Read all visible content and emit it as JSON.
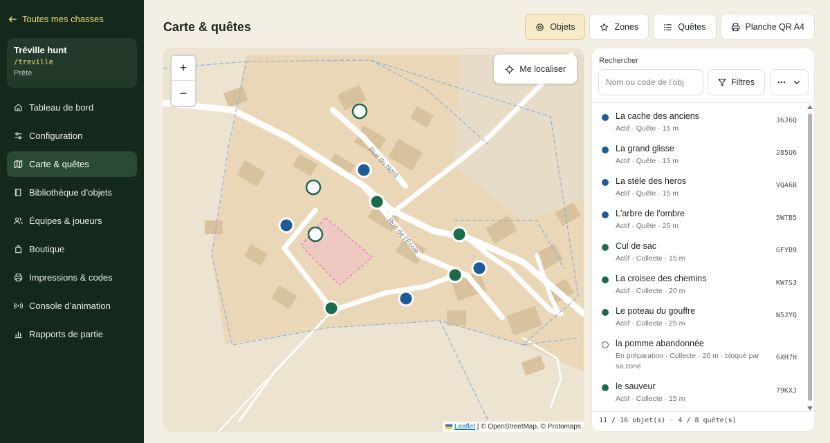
{
  "sidebar": {
    "back_label": "Toutes mes chasses",
    "hunt": {
      "name": "Tréville hunt",
      "slug": "/treville",
      "status": "Prête"
    },
    "items": [
      {
        "label": "Tableau de bord",
        "icon": "home-icon"
      },
      {
        "label": "Configuration",
        "icon": "sliders-icon"
      },
      {
        "label": "Carte & quêtes",
        "icon": "map-icon",
        "active": true
      },
      {
        "label": "Bibliothèque d’objets",
        "icon": "book-icon"
      },
      {
        "label": "Équipes & joueurs",
        "icon": "users-icon"
      },
      {
        "label": "Boutique",
        "icon": "bag-icon"
      },
      {
        "label": "Impressions & codes",
        "icon": "printer-icon"
      },
      {
        "label": "Console d’animation",
        "icon": "radio-icon"
      },
      {
        "label": "Rapports de partie",
        "icon": "chart-icon"
      }
    ]
  },
  "header": {
    "title": "Carte & quêtes",
    "buttons": {
      "objets": "Objets",
      "zones": "Zones",
      "quetes": "Quêtes",
      "qr": "Planche QR A4"
    }
  },
  "map": {
    "zoom_in": "+",
    "zoom_out": "−",
    "locate_label": "Me localiser",
    "streets": {
      "nord": "Rue du Nord",
      "ecole": "Rue de l'École"
    },
    "attribution": {
      "leaflet": "Leaflet",
      "rest": " | © OpenStreetMap, © Protomaps"
    },
    "colors": {
      "quest": "#1f5a99",
      "collect": "#1b6b4a",
      "draft": "#ffffff"
    }
  },
  "panel": {
    "search_label": "Rechercher",
    "search_placeholder": "Nom ou code de l’obj",
    "filters_label": "Filtres",
    "items": [
      {
        "title": "La cache des anciens",
        "meta": "Actif · Quête · 15 m",
        "code": "J6J6Q",
        "kind": "quest"
      },
      {
        "title": "La grand glisse",
        "meta": "Actif · Quête · 15 m",
        "code": "285U6",
        "kind": "quest"
      },
      {
        "title": "La stèle des heros",
        "meta": "Actif · Quête · 15 m",
        "code": "VQA6B",
        "kind": "quest"
      },
      {
        "title": "L'arbre de l'ombre",
        "meta": "Actif · Quête · 25 m",
        "code": "5WTB5",
        "kind": "quest"
      },
      {
        "title": "Cul de sac",
        "meta": "Actif · Collecte · 15 m",
        "code": "GFYB9",
        "kind": "collect"
      },
      {
        "title": "La croisee des chemins",
        "meta": "Actif · Collecte · 20 m",
        "code": "KW7S3",
        "kind": "collect"
      },
      {
        "title": "Le poteau du gouffre",
        "meta": "Actif · Collecte · 25 m",
        "code": "N5JYQ",
        "kind": "collect"
      },
      {
        "title": "la pomme abandonnée",
        "meta": "En préparation · Collecte · 20 m · bloqué par sa zone",
        "code": "6XH7H",
        "kind": "draft"
      },
      {
        "title": "le sauveur",
        "meta": "Actif · Collecte · 15 m",
        "code": "79KXJ",
        "kind": "collect"
      }
    ],
    "footer": "11 / 16 objet(s) · 4 / 8 quête(s)"
  }
}
